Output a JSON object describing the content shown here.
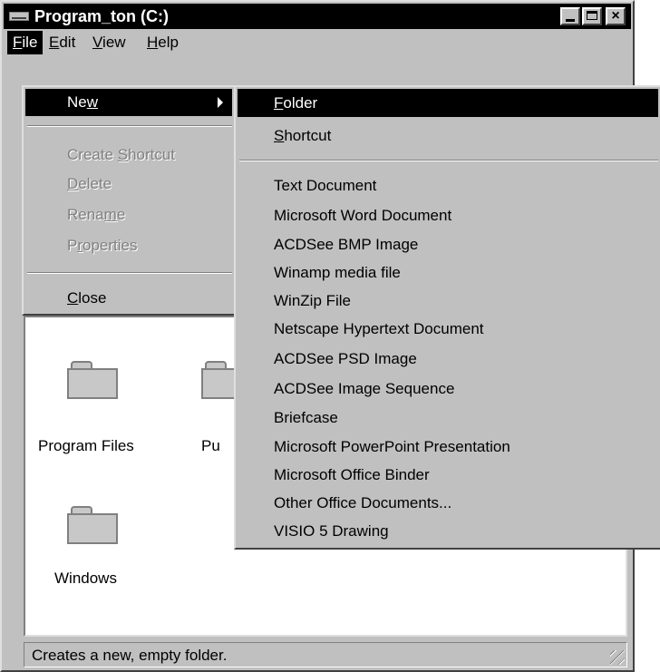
{
  "window": {
    "title": "Program_ton (C:)",
    "buttons": {
      "minimize": "minimize",
      "maximize": "maximize",
      "close": "×"
    }
  },
  "menubar": {
    "items": [
      {
        "pre": "",
        "key": "F",
        "post": "ile"
      },
      {
        "pre": "",
        "key": "E",
        "post": "dit"
      },
      {
        "pre": "",
        "key": "V",
        "post": "iew"
      },
      {
        "pre": "",
        "key": "H",
        "post": "elp"
      }
    ]
  },
  "file_menu": {
    "items": [
      {
        "pre": "Ne",
        "key": "w",
        "post": ""
      },
      {
        "pre": "Create ",
        "key": "S",
        "post": "hortcut"
      },
      {
        "pre": "",
        "key": "D",
        "post": "elete"
      },
      {
        "pre": "Rena",
        "key": "m",
        "post": "e"
      },
      {
        "pre": "P",
        "key": "r",
        "post": "operties"
      },
      {
        "pre": "",
        "key": "C",
        "post": "lose"
      }
    ]
  },
  "new_submenu": {
    "items": [
      {
        "pre": "",
        "key": "F",
        "post": "older"
      },
      {
        "pre": "",
        "key": "S",
        "post": "hortcut"
      },
      {
        "pre": "Text Document",
        "key": "",
        "post": ""
      },
      {
        "pre": "Microsoft Word Document",
        "key": "",
        "post": ""
      },
      {
        "pre": "ACDSee BMP Image",
        "key": "",
        "post": ""
      },
      {
        "pre": "Winamp media file",
        "key": "",
        "post": ""
      },
      {
        "pre": "WinZip File",
        "key": "",
        "post": ""
      },
      {
        "pre": "Netscape Hypertext Document",
        "key": "",
        "post": ""
      },
      {
        "pre": "ACDSee PSD Image",
        "key": "",
        "post": ""
      },
      {
        "pre": "ACDSee Image Sequence",
        "key": "",
        "post": ""
      },
      {
        "pre": "Briefcase",
        "key": "",
        "post": ""
      },
      {
        "pre": "Microsoft PowerPoint Presentation",
        "key": "",
        "post": ""
      },
      {
        "pre": "Microsoft Office Binder",
        "key": "",
        "post": ""
      },
      {
        "pre": "Other Office Documents...",
        "key": "",
        "post": ""
      },
      {
        "pre": "VISIO 5 Drawing",
        "key": "",
        "post": ""
      }
    ]
  },
  "folders": [
    {
      "label": "Program Files"
    },
    {
      "label": "Pu"
    },
    {
      "label": "Windows"
    }
  ],
  "statusbar": {
    "text": "Creates a new, empty folder."
  },
  "colors": {
    "face": "#c0c0c0",
    "highlight": "#000000",
    "disabled": "#808080"
  }
}
